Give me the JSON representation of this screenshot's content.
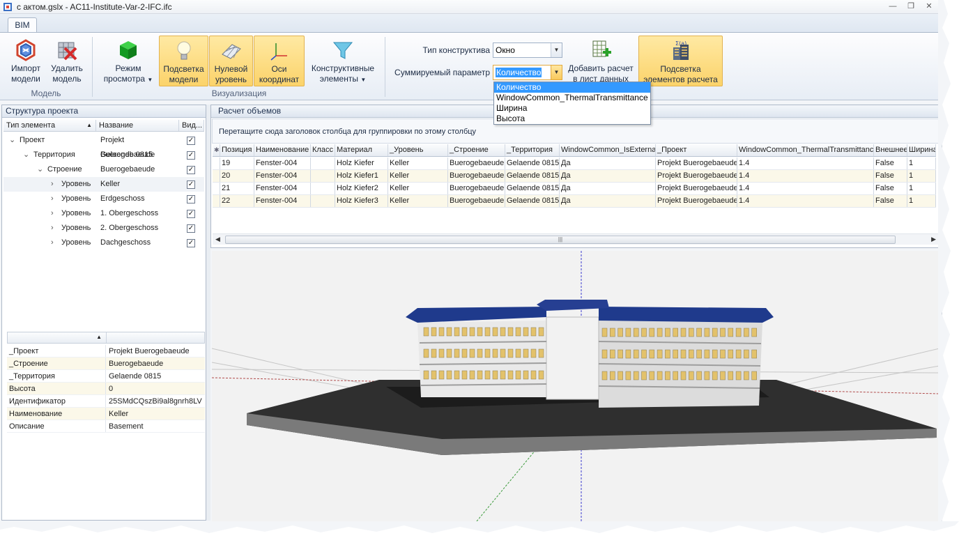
{
  "window": {
    "title": "с актом.gslx - AC11-Institute-Var-2-IFC.ifc"
  },
  "ribbon": {
    "tab": "BIM",
    "groups": {
      "model": "Модель",
      "visual": "Визуализация"
    },
    "buttons": {
      "import": "Импорт модели",
      "delete": "Удалить модель",
      "view_mode": "Режим просмотра",
      "highlight": "Подсветка модели",
      "zero_level": "Нулевой уровень",
      "axes": "Оси координат",
      "elements": "Конструктивные элементы",
      "add_calc": "Добавить расчет в лист данных",
      "highlight_calc": "Подсветка элементов расчета"
    },
    "construct_type_label": "Тип конструктива",
    "construct_type_value": "Окно",
    "sum_param_label": "Суммируемый параметр",
    "sum_param_value": "Количество",
    "sum_param_options": [
      "Количество",
      "WindowCommon_ThermalTransmittance",
      "Ширина",
      "Высота"
    ]
  },
  "structure": {
    "title": "Структура проекта",
    "columns": [
      "Тип элемента",
      "Название",
      "Вид..."
    ],
    "rows": [
      {
        "type": "Проект",
        "name": "Projekt Buerogebaeude",
        "visible": true,
        "level": 0
      },
      {
        "type": "Территория",
        "name": "Gelaende 0815",
        "visible": true,
        "level": 1
      },
      {
        "type": "Строение",
        "name": "Buerogebaeude",
        "visible": true,
        "level": 2
      },
      {
        "type": "Уровень",
        "name": "Keller",
        "visible": true,
        "level": 3
      },
      {
        "type": "Уровень",
        "name": "Erdgeschoss",
        "visible": true,
        "level": 3
      },
      {
        "type": "Уровень",
        "name": "1. Obergeschoss",
        "visible": true,
        "level": 3
      },
      {
        "type": "Уровень",
        "name": "2. Obergeschoss",
        "visible": true,
        "level": 3
      },
      {
        "type": "Уровень",
        "name": "Dachgeschoss",
        "visible": true,
        "level": 3
      }
    ]
  },
  "properties": [
    {
      "key": "_Проект",
      "value": "Projekt Buerogebaeude"
    },
    {
      "key": "_Строение",
      "value": "Buerogebaeude"
    },
    {
      "key": "_Территория",
      "value": "Gelaende 0815"
    },
    {
      "key": "Высота",
      "value": "0"
    },
    {
      "key": "Идентификатор",
      "value": "25SMdCQszBi9al8gnrh8LV"
    },
    {
      "key": "Наименование",
      "value": "Keller"
    },
    {
      "key": "Описание",
      "value": "Basement"
    }
  ],
  "calc": {
    "title": "Расчет объемов",
    "group_hint": "Перетащите сюда заголовок столбца для группировки по этому столбцу",
    "columns": [
      "Позиция",
      "Наименование",
      "Класс",
      "Материал",
      "_Уровень",
      "_Строение",
      "_Территория",
      "WindowCommon_IsExternal",
      "_Проект",
      "WindowCommon_ThermalTransmittance",
      "Внешнее",
      "Ширина"
    ],
    "rows": [
      [
        "19",
        "Fenster-004",
        "",
        "Holz Kiefer",
        "Keller",
        "Buerogebaeude",
        "Gelaende 0815",
        "Да",
        "Projekt Buerogebaeude",
        "1.4",
        "False",
        "1"
      ],
      [
        "20",
        "Fenster-004",
        "",
        "Holz Kiefer1",
        "Keller",
        "Buerogebaeude",
        "Gelaende 0815",
        "Да",
        "Projekt Buerogebaeude",
        "1.4",
        "False",
        "1"
      ],
      [
        "21",
        "Fenster-004",
        "",
        "Holz Kiefer2",
        "Keller",
        "Buerogebaeude",
        "Gelaende 0815",
        "Да",
        "Projekt Buerogebaeude",
        "1.4",
        "False",
        "1"
      ],
      [
        "22",
        "Fenster-004",
        "",
        "Holz Kiefer3",
        "Keller",
        "Buerogebaeude",
        "Gelaende 0815",
        "Да",
        "Projekt Buerogebaeude",
        "1.4",
        "False",
        "1"
      ]
    ]
  }
}
